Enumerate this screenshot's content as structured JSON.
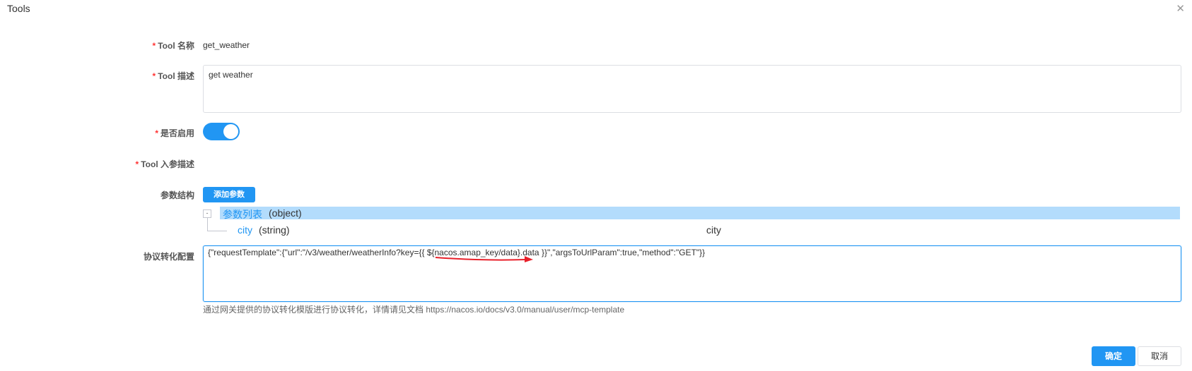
{
  "dialog": {
    "title": "Tools",
    "close_glyph": "✕"
  },
  "form": {
    "required_mark": "*",
    "tool_name": {
      "label": "Tool 名称",
      "value": "get_weather"
    },
    "tool_description": {
      "label": "Tool 描述",
      "value": "get weather"
    },
    "enabled": {
      "label": "是否启用",
      "on": true
    },
    "input_schema": {
      "label": "Tool 入参描述"
    },
    "param_structure": {
      "label": "参数结构",
      "add_button": "添加参数",
      "tree": {
        "switch_glyph": "-",
        "root": {
          "name": "参数列表",
          "type": "(object)"
        },
        "children": [
          {
            "name": "city",
            "type": "(string)",
            "description": "city"
          }
        ]
      }
    },
    "protocol_config": {
      "label": "协议转化配置",
      "value": "{\"requestTemplate\":{\"url\":\"/v3/weather/weatherInfo?key={{ ${nacos.amap_key/data}.data }}\",\"argsToUrlParam\":true,\"method\":\"GET\"}}",
      "hint": "通过网关提供的协议转化模版进行协议转化，详情请见文档 https://nacos.io/docs/v3.0/manual/user/mcp-template"
    }
  },
  "footer": {
    "ok_label": "确定",
    "cancel_label": "取消"
  },
  "colors": {
    "primary": "#2196f3",
    "required": "#ff3333",
    "tree_highlight": "#b3dcfc",
    "annotation_arrow": "#e8202a"
  }
}
